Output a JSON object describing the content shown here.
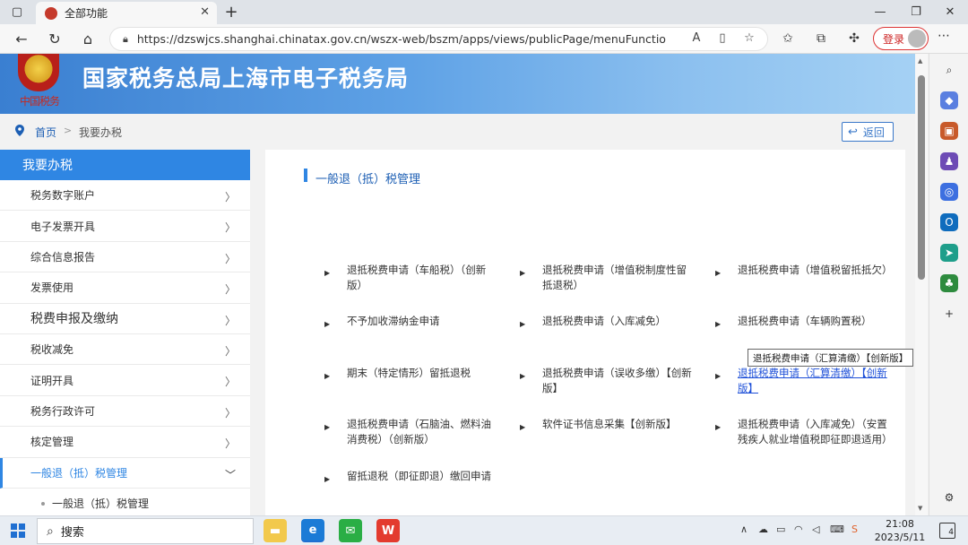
{
  "browser": {
    "tab_title": "全部功能",
    "url": "https://dzswjcs.shanghai.chinatax.gov.cn/wszx-web/bszm/apps/views/publicPage/menuFunctions.html?type=wy...",
    "login_label": "登录"
  },
  "site": {
    "emblem_text": "中国税务",
    "title": "国家税务总局上海市电子税务局"
  },
  "breadcrumb": {
    "home": "首页",
    "separator": ">",
    "current": "我要办税",
    "back_label": "返回"
  },
  "sidebar": {
    "header": "我要办税",
    "items": [
      {
        "label": "税务数字账户"
      },
      {
        "label": "电子发票开具"
      },
      {
        "label": "综合信息报告"
      },
      {
        "label": "发票使用"
      },
      {
        "label": "税费申报及缴纳"
      },
      {
        "label": "税收减免"
      },
      {
        "label": "证明开具"
      },
      {
        "label": "税务行政许可"
      },
      {
        "label": "核定管理"
      },
      {
        "label": "一般退（抵）税管理"
      }
    ],
    "sub_item": "一般退（抵）税管理",
    "chev_right": "〉",
    "chev_down": "﹀"
  },
  "main": {
    "section_title": "一般退（抵）税管理",
    "items": [
      {
        "label": "退抵税费申请（车船税）（创新版）"
      },
      {
        "label": "退抵税费申请（增值税制度性留抵退税）"
      },
      {
        "label": "退抵税费申请（增值税留抵抵欠）"
      },
      {
        "label": "不予加收滞纳金申请"
      },
      {
        "label": "退抵税费申请（入库减免）"
      },
      {
        "label": "退抵税费申请（车辆购置税）"
      },
      {
        "label": "期末（特定情形）留抵退税"
      },
      {
        "label": "退抵税费申请（误收多缴）【创新版】"
      },
      {
        "label": "退抵税费申请（汇算清缴）【创新版】"
      },
      {
        "label": "退抵税费申请（石脑油、燃料油消费税）（创新版）"
      },
      {
        "label": "软件证书信息采集【创新版】"
      },
      {
        "label": "退抵税费申请（入库减免）（安置残疾人就业增值税即征即退适用）"
      },
      {
        "label": "留抵退税（即征即退）缴回申请"
      }
    ],
    "tooltip": "退抵税费申请（汇算清缴）【创新版】"
  },
  "taskbar": {
    "search_label": "搜索",
    "time": "21:08",
    "date": "2023/5/11",
    "notification_count": "4",
    "wps_label": "W"
  },
  "colors": {
    "accent": "#2f86e3",
    "link": "#1d5fb4",
    "login_red": "#cc2222"
  }
}
